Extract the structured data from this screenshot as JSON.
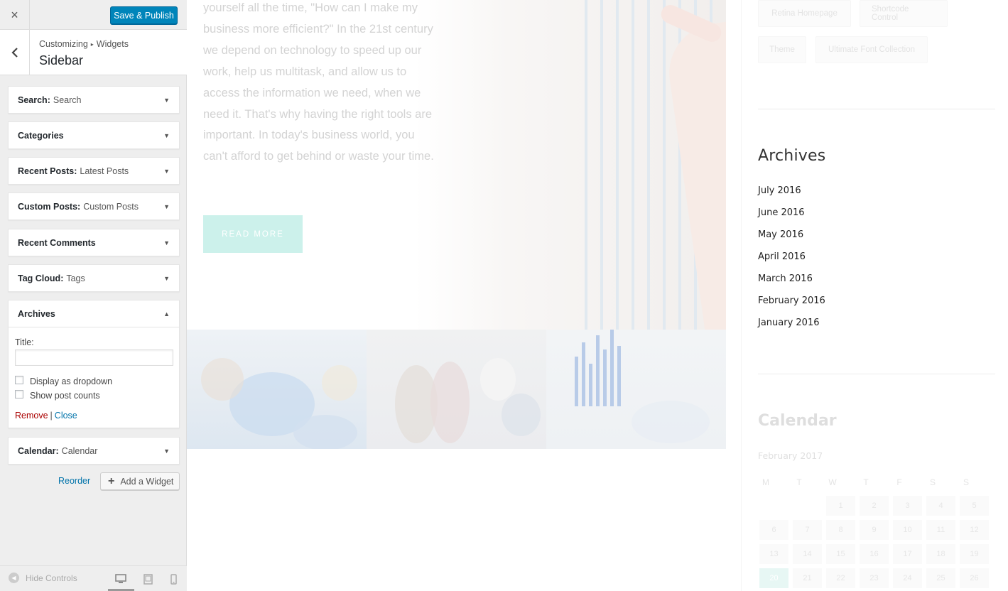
{
  "header": {
    "close_icon": "×",
    "publish_label": "Save & Publish"
  },
  "section": {
    "breadcrumb_root": "Customizing",
    "breadcrumb_sep": "▸",
    "breadcrumb_leaf": "Widgets",
    "title": "Sidebar"
  },
  "widgets": [
    {
      "name": "Search",
      "instance": "Search"
    },
    {
      "name": "Categories",
      "instance": ""
    },
    {
      "name": "Recent Posts",
      "instance": "Latest Posts"
    },
    {
      "name": "Custom Posts",
      "instance": "Custom Posts"
    },
    {
      "name": "Recent Comments",
      "instance": ""
    },
    {
      "name": "Tag Cloud",
      "instance": "Tags"
    },
    {
      "name": "Archives",
      "instance": ""
    },
    {
      "name": "Calendar",
      "instance": "Calendar"
    }
  ],
  "archives_form": {
    "title_label": "Title:",
    "title_value": "",
    "dropdown_label": "Display as dropdown",
    "counts_label": "Show post counts",
    "remove_label": "Remove",
    "pipe": "|",
    "close_label": "Close"
  },
  "actions": {
    "reorder_label": "Reorder",
    "add_widget_label": "Add a Widget"
  },
  "footer": {
    "hide_controls_label": "Hide Controls",
    "active_device": "desktop"
  },
  "preview": {
    "hero_text": "yourself all the time, \"How can I make my business more efficient?\" In the 21st century we depend on technology to speed up our work, help us multitask, and allow us to access the information we need, when we need it. That's why having the right tools are important. In today's business world, you can't afford to get behind or waste your time.",
    "read_more_label": "READ MORE",
    "tags": [
      "Retina Homepage",
      "Shortcode Control",
      "Theme",
      "Ultimate Font Collection"
    ],
    "archives_title": "Archives",
    "archives": [
      "July 2016",
      "June 2016",
      "May 2016",
      "April 2016",
      "March 2016",
      "February 2016",
      "January 2016"
    ],
    "calendar_title": "Calendar",
    "calendar_month": "February 2017",
    "calendar_days": [
      "M",
      "T",
      "W",
      "T",
      "F",
      "S",
      "S"
    ],
    "calendar_rows": [
      [
        "",
        "",
        "1",
        "2",
        "3",
        "4",
        "5"
      ],
      [
        "6",
        "7",
        "8",
        "9",
        "10",
        "11",
        "12"
      ],
      [
        "13",
        "14",
        "15",
        "16",
        "17",
        "18",
        "19"
      ],
      [
        "20",
        "21",
        "22",
        "23",
        "24",
        "25",
        "26"
      ]
    ],
    "calendar_today": "20"
  },
  "colors": {
    "primary_button": "#0085ba",
    "link": "#0073aa",
    "remove": "#aa0000",
    "accent_teal": "#ccf1eb"
  }
}
